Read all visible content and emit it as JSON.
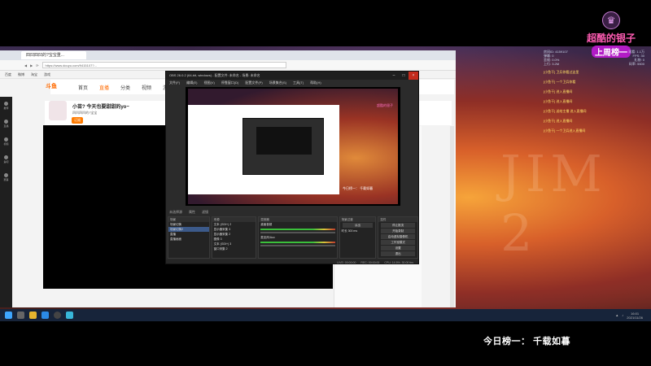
{
  "stream": {
    "brand_name": "超酷的银子",
    "brand_sub": "上周榜一",
    "bottom_banner": "今日榜一：  千载如暮",
    "watermark": "JIM 2"
  },
  "browser": {
    "tab_title": "四凹四凹的?宝宝重...",
    "url": "https://www.douyu.com/9415107?...",
    "bookmarks": [
      "百度",
      "微博",
      "淘宝",
      "游戏"
    ],
    "site_logo": "斗鱼",
    "nav": [
      "首页",
      "直播",
      "分类",
      "视频",
      "游戏"
    ],
    "room_title": "小苗?  今天也要甜甜的yo~",
    "room_meta": "四凹四凹的?宝宝",
    "follow_label": "订阅",
    "rail": [
      "推荐",
      "直播",
      "视频",
      "鱼吧",
      "赛事"
    ]
  },
  "obs": {
    "title": "OBS 26.0.2 (64-bit, windows) - 配置文件: 未命名 - 场景: 未命名",
    "menu": [
      "文件(F)",
      "编辑(E)",
      "视图(V)",
      "停靠窗口(D)",
      "配置文件(P)",
      "场景集合(S)",
      "工具(T)",
      "帮助(H)"
    ],
    "preview_caption": "今日榜一：  千载如暮",
    "preview_brand": "超酷的银子",
    "docks_label": [
      "未选择源",
      "属性",
      "滤镜"
    ],
    "scenes_head": "场景",
    "scenes": [
      "场景切换",
      "场景切换2",
      "直播",
      "直播画面"
    ],
    "sources_head": "来源",
    "sources": [
      "文本 (GDI+) 2",
      "显示器采集 3",
      "显示器采集 2",
      "图像 3",
      "文本 (GDI+) 3",
      "窗口采集 2"
    ],
    "mixer_head": "混音器",
    "mixer": [
      "桌面音频",
      "麦克风/Aux"
    ],
    "transitions_head": "场景过渡",
    "transition_value": "淡出",
    "duration_label": "时长",
    "duration_value": "300 ms",
    "controls_head": "控件",
    "controls": [
      "停止推流",
      "开始录制",
      "启动虚拟摄像机",
      "工作室模式",
      "设置",
      "退出"
    ],
    "status": [
      "LIVE: 00:00:00",
      "REC: 00:00:00",
      "CPU: 14.5%, 30.00 fps"
    ]
  },
  "overlay_stats": [
    [
      "房间ID: 4159107",
      "观看: 1.1万"
    ],
    [
      "弹幕: 0",
      "FPS: 30"
    ],
    [
      "丢帧: 0.0%",
      "礼物: 0"
    ],
    [
      "上行: 3.2M",
      "码率: 5500"
    ]
  ],
  "overlay_chat": [
    "[小鱼干] 卫兵你看过这里",
    "[小鱼干] 一个卫兵你看",
    "[小鱼干] 进入直播间",
    "[小鱼干] 进入直播间",
    "[小鱼干] 送给主播 进入直播间",
    "[小鱼干] 进入直播间",
    "[小鱼干] 一个卫兵进入直播间"
  ],
  "taskbar": {
    "time": "16:01",
    "date": "2021/11/26"
  },
  "colors": {
    "brand_pink": "#ff5cb3",
    "badge_purple": "#b21cc6",
    "chat_yellow": "#ffe066",
    "obs_bg": "#2b2b2b"
  }
}
